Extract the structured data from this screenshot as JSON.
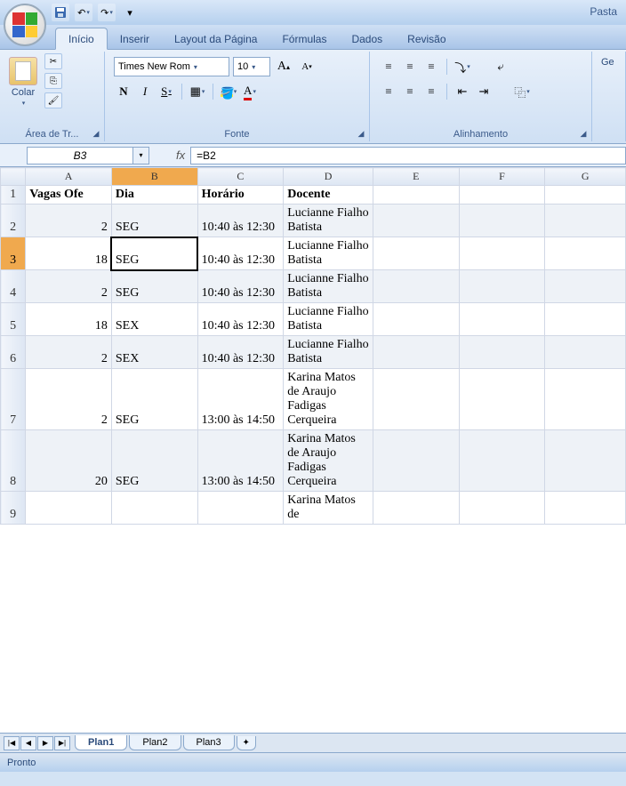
{
  "title": "Pasta",
  "tabs": {
    "inicio": "Início",
    "inserir": "Inserir",
    "layout": "Layout da Página",
    "formulas": "Fórmulas",
    "dados": "Dados",
    "revisao": "Revisão"
  },
  "ribbon": {
    "clipboard": {
      "paste": "Colar",
      "group": "Área de Tr..."
    },
    "font": {
      "name": "Times New Rom",
      "size": "10",
      "group": "Fonte",
      "bold": "N",
      "italic": "I",
      "underline": "S",
      "fontcolor": "A"
    },
    "align": {
      "group": "Alinhamento"
    },
    "general_label": "Ge"
  },
  "namebox": "B3",
  "fx": "fx",
  "formula": "=B2",
  "columns": [
    "A",
    "B",
    "C",
    "D",
    "E",
    "F",
    "G"
  ],
  "headers": {
    "A": "Vagas Ofe",
    "B": "Dia",
    "C": "Horário",
    "D": "Docente"
  },
  "rows": [
    {
      "n": "1"
    },
    {
      "n": "2",
      "A": "2",
      "B": "SEG",
      "C": "10:40 às 12:30",
      "D": "Lucianne Fialho Batista"
    },
    {
      "n": "3",
      "A": "18",
      "B": "SEG",
      "C": "10:40 às 12:30",
      "D": "Lucianne Fialho Batista",
      "sel": true
    },
    {
      "n": "4",
      "A": "2",
      "B": "SEG",
      "C": "10:40 às 12:30",
      "D": "Lucianne Fialho Batista"
    },
    {
      "n": "5",
      "A": "18",
      "B": "SEX",
      "C": "10:40 às 12:30",
      "D": "Lucianne Fialho Batista"
    },
    {
      "n": "6",
      "A": "2",
      "B": "SEX",
      "C": "10:40 às 12:30",
      "D": "Lucianne Fialho Batista"
    },
    {
      "n": "7",
      "A": "2",
      "B": "SEG",
      "C": "13:00 às 14:50",
      "D": "Karina Matos de Araujo Fadigas Cerqueira"
    },
    {
      "n": "8",
      "A": "20",
      "B": "SEG",
      "C": "13:00 às 14:50",
      "D": "Karina Matos de Araujo Fadigas Cerqueira"
    },
    {
      "n": "9",
      "D": "Karina Matos de"
    }
  ],
  "sheets": {
    "s1": "Plan1",
    "s2": "Plan2",
    "s3": "Plan3"
  },
  "status": "Pronto"
}
